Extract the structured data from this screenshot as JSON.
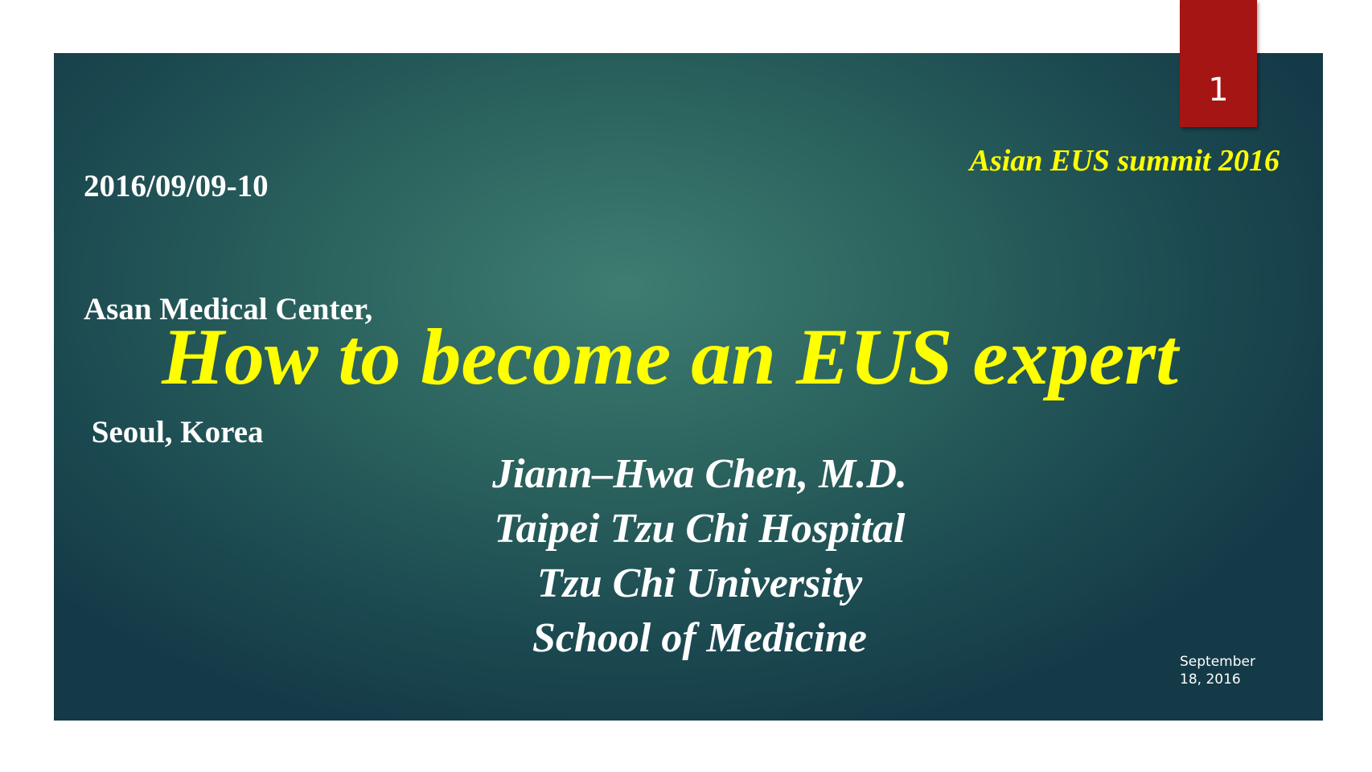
{
  "slide": {
    "number": "1",
    "date_location": [
      "2016/09/09-10",
      "Asan Medical Center,",
      " Seoul, Korea"
    ],
    "event": "Asian EUS summit 2016",
    "title": "How to become an EUS expert",
    "author_lines": [
      "Jiann–Hwa Chen, M.D.",
      "Taipei Tzu Chi Hospital",
      "Tzu Chi University",
      "School of Medicine"
    ],
    "footer_date_line1": "September",
    "footer_date_line2": "18, 2016"
  },
  "colors": {
    "background_top": "#3e7d72",
    "background_edge": "#143a47",
    "accent_text": "#ffff00",
    "tab_red": "#a51514"
  }
}
